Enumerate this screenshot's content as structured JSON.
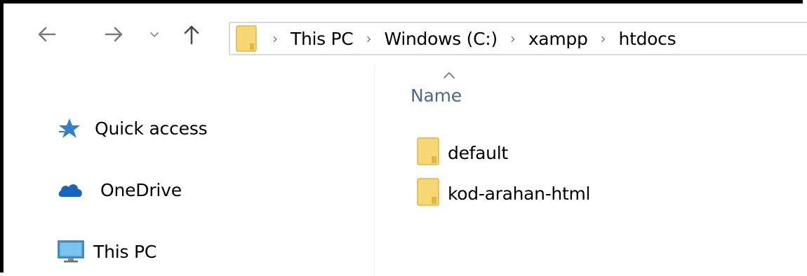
{
  "nav": {
    "back_icon": "arrow-left-icon",
    "forward_icon": "arrow-right-icon",
    "recent_icon": "chevron-down-icon",
    "up_icon": "arrow-up-icon"
  },
  "address_bar": {
    "folder_icon": "folder-icon",
    "breadcrumbs": [
      "This PC",
      "Windows (C:)",
      "xampp",
      "htdocs"
    ]
  },
  "sidebar": {
    "items": [
      {
        "label": "Quick access",
        "icon": "star-icon"
      },
      {
        "label": "OneDrive",
        "icon": "cloud-icon"
      },
      {
        "label": "This PC",
        "icon": "monitor-icon"
      }
    ]
  },
  "content": {
    "column_header": "Name",
    "sort_icon": "chevron-up-icon",
    "files": [
      {
        "name": "default",
        "icon": "folder-icon"
      },
      {
        "name": "kod-arahan-html",
        "icon": "folder-icon"
      }
    ]
  },
  "colors": {
    "header_text": "#4c6a8f",
    "folder_fill": "#f8d775",
    "folder_dark": "#e0b644",
    "star_blue": "#2f7fd6",
    "cloud_blue": "#1565c0",
    "monitor_blue": "#4aa3df"
  }
}
